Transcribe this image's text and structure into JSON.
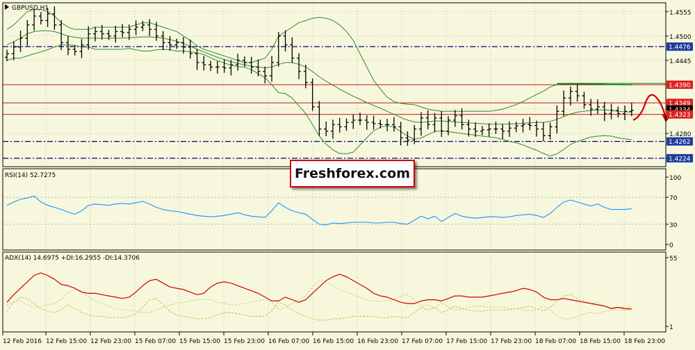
{
  "colors": {
    "background": "#F7F7DE",
    "panel_border": "#000000",
    "grid": "#9B9B80",
    "candle": "#000000",
    "bollinger": "#2E8B2E",
    "level_red": "#CC1111",
    "level_blue": "#000080",
    "price_box_red": "#E02020",
    "price_box_blue": "#1F3C9C",
    "price_box_black": "#000000",
    "rsi_line": "#1E90FF",
    "adx_line": "#D00000",
    "plus_di_line": "#9ACD32",
    "minus_di_line": "#CCCC66",
    "forecast_arrow": "#CC0000",
    "channel_line": "#008000"
  },
  "watermark": {
    "text": "Freshforex.com"
  },
  "chart_data": [
    {
      "type": "candlestick",
      "title": "GBPUSD,H1",
      "ylim": [
        1.4205,
        1.4575
      ],
      "y_ticks": [
        "1.4555",
        "1.4500",
        "1.4445",
        "1.4390",
        "1.4335",
        "1.4280",
        "1.4224"
      ],
      "y_tick_values": [
        1.4555,
        1.45,
        1.4445,
        1.439,
        1.4335,
        1.428,
        1.4224
      ],
      "x_ticks": [
        "12 Feb 2016",
        "12 Feb 15:00",
        "12 Feb 23:00",
        "15 Feb 07:00",
        "15 Feb 15:00",
        "15 Feb 23:00",
        "16 Feb 07:00",
        "16 Feb 15:00",
        "16 Feb 23:00",
        "17 Feb 07:00",
        "17 Feb 15:00",
        "17 Feb 23:00",
        "18 Feb 07:00",
        "18 Feb 15:00",
        "18 Feb 23:00"
      ],
      "grid": true,
      "close_prices": [
        1.446,
        1.4475,
        1.4495,
        1.4525,
        1.4545,
        1.4535,
        1.455,
        1.4525,
        1.4485,
        1.447,
        1.4465,
        1.448,
        1.4505,
        1.451,
        1.4505,
        1.45,
        1.451,
        1.4508,
        1.4515,
        1.452,
        1.4525,
        1.4515,
        1.45,
        1.4485,
        1.448,
        1.4485,
        1.4475,
        1.446,
        1.444,
        1.4435,
        1.443,
        1.443,
        1.4428,
        1.4435,
        1.4445,
        1.444,
        1.443,
        1.442,
        1.441,
        1.444,
        1.45,
        1.448,
        1.445,
        1.442,
        1.4395,
        1.434,
        1.429,
        1.4285,
        1.43,
        1.4295,
        1.4305,
        1.431,
        1.431,
        1.4305,
        1.4302,
        1.43,
        1.43,
        1.4295,
        1.427,
        1.4265,
        1.429,
        1.4315,
        1.43,
        1.4315,
        1.4285,
        1.431,
        1.432,
        1.43,
        1.429,
        1.4285,
        1.4288,
        1.429,
        1.429,
        1.4285,
        1.4292,
        1.4297,
        1.43,
        1.4298,
        1.429,
        1.4275,
        1.4295,
        1.433,
        1.436,
        1.4375,
        1.4365,
        1.4345,
        1.4335,
        1.434,
        1.4325,
        1.4332,
        1.4325,
        1.433,
        1.4332
      ],
      "bollinger_upper": [
        1.4515,
        1.4525,
        1.454,
        1.4555,
        1.456,
        1.456,
        1.4555,
        1.4545,
        1.453,
        1.452,
        1.4515,
        1.4515,
        1.4515,
        1.452,
        1.452,
        1.452,
        1.452,
        1.452,
        1.452,
        1.4525,
        1.453,
        1.453,
        1.4525,
        1.452,
        1.4515,
        1.451,
        1.45,
        1.449,
        1.4478,
        1.447,
        1.4465,
        1.446,
        1.4455,
        1.445,
        1.4445,
        1.444,
        1.444,
        1.4445,
        1.445,
        1.447,
        1.45,
        1.451,
        1.452,
        1.453,
        1.4535,
        1.454,
        1.4542,
        1.454,
        1.4535,
        1.4525,
        1.451,
        1.449,
        1.446,
        1.443,
        1.44,
        1.438,
        1.4362,
        1.4352,
        1.4348,
        1.4346,
        1.4345,
        1.434,
        1.4335,
        1.4332,
        1.433,
        1.433,
        1.433,
        1.433,
        1.433,
        1.433,
        1.433,
        1.433,
        1.4332,
        1.4335,
        1.434,
        1.4345,
        1.4352,
        1.436,
        1.4368,
        1.4375,
        1.4385,
        1.439,
        1.4392,
        1.4393,
        1.4393,
        1.4393,
        1.4392,
        1.4392,
        1.4391,
        1.439,
        1.439,
        1.439,
        1.439
      ],
      "bollinger_middle": [
        1.448,
        1.4487,
        1.4495,
        1.4505,
        1.451,
        1.4512,
        1.4512,
        1.451,
        1.4505,
        1.45,
        1.4497,
        1.4495,
        1.4495,
        1.4495,
        1.4495,
        1.4495,
        1.4495,
        1.4495,
        1.4496,
        1.4497,
        1.4498,
        1.4498,
        1.4497,
        1.4495,
        1.4492,
        1.4488,
        1.4483,
        1.4477,
        1.447,
        1.4464,
        1.4458,
        1.4452,
        1.4447,
        1.4442,
        1.4438,
        1.4435,
        1.4432,
        1.443,
        1.4428,
        1.443,
        1.4436,
        1.444,
        1.444,
        1.4436,
        1.443,
        1.442,
        1.4408,
        1.4398,
        1.4389,
        1.438,
        1.4372,
        1.4364,
        1.4357,
        1.435,
        1.4343,
        1.4337,
        1.433,
        1.4323,
        1.4316,
        1.431,
        1.4306,
        1.4305,
        1.4306,
        1.4308,
        1.4308,
        1.4307,
        1.4306,
        1.4305,
        1.4304,
        1.4303,
        1.4302,
        1.4301,
        1.4301,
        1.4301,
        1.4301,
        1.4302,
        1.4303,
        1.4304,
        1.4305,
        1.4305,
        1.4307,
        1.4312,
        1.4318,
        1.4324,
        1.4328,
        1.433,
        1.4332,
        1.4333,
        1.4333,
        1.4332,
        1.433,
        1.4329,
        1.4328
      ],
      "bollinger_lower": [
        1.4445,
        1.445,
        1.445,
        1.4455,
        1.446,
        1.4464,
        1.4469,
        1.4475,
        1.448,
        1.448,
        1.4479,
        1.4475,
        1.4475,
        1.447,
        1.447,
        1.447,
        1.447,
        1.447,
        1.4472,
        1.4469,
        1.4466,
        1.4466,
        1.4469,
        1.447,
        1.4469,
        1.4466,
        1.4466,
        1.4464,
        1.4462,
        1.4458,
        1.4451,
        1.4444,
        1.4439,
        1.4434,
        1.4431,
        1.443,
        1.4424,
        1.4415,
        1.4406,
        1.439,
        1.4372,
        1.437,
        1.436,
        1.4342,
        1.4325,
        1.43,
        1.4274,
        1.4256,
        1.4243,
        1.4235,
        1.4234,
        1.4238,
        1.4254,
        1.427,
        1.4286,
        1.4294,
        1.4298,
        1.4294,
        1.4284,
        1.4274,
        1.4267,
        1.427,
        1.4277,
        1.4284,
        1.4286,
        1.4284,
        1.4282,
        1.428,
        1.4278,
        1.4276,
        1.4274,
        1.4272,
        1.427,
        1.4267,
        1.4262,
        1.4259,
        1.4254,
        1.4248,
        1.4242,
        1.4235,
        1.4229,
        1.4234,
        1.4244,
        1.4255,
        1.4262,
        1.4267,
        1.4272,
        1.4274,
        1.4275,
        1.4274,
        1.427,
        1.4268,
        1.4266
      ],
      "levels": [
        {
          "value": 1.4476,
          "label": "1.4476",
          "style": "blue-dashdot"
        },
        {
          "value": 1.439,
          "label": "1.4390",
          "style": "red"
        },
        {
          "value": 1.4349,
          "label": "1.4349",
          "style": "red"
        },
        {
          "value": 1.4334,
          "label": "1.4334",
          "style": "current"
        },
        {
          "value": 1.4323,
          "label": "1.4323",
          "style": "red"
        },
        {
          "value": 1.4262,
          "label": "1.4262",
          "style": "blue-dashdot"
        },
        {
          "value": 1.4224,
          "label": "1.4224",
          "style": "blue-dashdot"
        }
      ]
    },
    {
      "type": "line",
      "title": "RSI(14) 52.7275",
      "ylim": [
        0,
        100
      ],
      "y_ticks": [
        "100",
        "70",
        "30",
        "0"
      ],
      "y_tick_values": [
        100,
        70,
        30,
        0
      ],
      "reference_lines": [
        70,
        30
      ],
      "values": [
        58,
        63,
        67,
        69,
        72,
        63,
        58,
        55,
        52,
        48,
        45,
        50,
        58,
        60,
        59,
        58,
        60,
        61,
        60,
        62,
        64,
        60,
        55,
        52,
        50,
        49,
        47,
        45,
        43,
        42,
        41,
        42,
        43,
        45,
        47,
        44,
        42,
        41,
        40,
        50,
        62,
        55,
        50,
        47,
        45,
        37,
        30,
        29,
        32,
        31,
        32,
        33,
        33,
        33,
        32,
        32,
        33,
        33,
        31,
        30,
        36,
        42,
        38,
        42,
        34,
        40,
        46,
        42,
        40,
        39,
        40,
        41,
        41,
        40,
        41,
        43,
        44,
        45,
        43,
        40,
        46,
        55,
        63,
        66,
        63,
        60,
        57,
        60,
        55,
        52,
        52,
        52,
        53
      ]
    },
    {
      "type": "line",
      "title": "ADX(14) 14.6975 +DI:16.2955 -DI:14.3706",
      "ylim": [
        0,
        55
      ],
      "y_ticks": [
        "55",
        "1"
      ],
      "y_tick_values": [
        55,
        1
      ],
      "series": [
        {
          "name": "ADX(14)",
          "values": [
            20,
            26,
            31,
            36,
            41,
            43,
            41,
            38,
            34,
            33,
            31,
            28,
            27,
            27,
            26,
            25,
            24,
            23,
            24,
            28,
            33,
            37,
            38,
            35,
            32,
            31,
            30,
            28,
            26,
            27,
            32,
            35,
            36,
            35,
            33,
            31,
            29,
            27,
            24,
            21,
            21,
            24,
            22,
            20,
            22,
            27,
            32,
            37,
            40,
            42,
            40,
            37,
            34,
            31,
            27,
            25,
            24,
            22,
            20,
            19,
            19,
            21,
            22,
            22,
            21,
            23,
            25,
            25,
            24,
            24,
            24,
            25,
            26,
            27,
            28,
            29,
            31,
            30,
            28,
            24,
            22,
            22,
            23,
            22,
            21,
            20,
            19,
            18,
            17,
            15,
            16,
            15,
            14.7
          ]
        },
        {
          "name": "+DI",
          "values": [
            13,
            20,
            24,
            23,
            19,
            15,
            13,
            12,
            14,
            18,
            15,
            12,
            10,
            9,
            9,
            8,
            8,
            8,
            9,
            11,
            16,
            22,
            23,
            18,
            13,
            10,
            9,
            8,
            7,
            7,
            8,
            10,
            12,
            12,
            11,
            10,
            9,
            9,
            9,
            13,
            20,
            18,
            14,
            11,
            9,
            7,
            6,
            6,
            7,
            7,
            8,
            9,
            9,
            9,
            9,
            8,
            8,
            9,
            8,
            8,
            12,
            16,
            14,
            16,
            12,
            14,
            17,
            15,
            14,
            13,
            13,
            14,
            14,
            14,
            14,
            15,
            16,
            17,
            15,
            13,
            16,
            21,
            25,
            26,
            23,
            21,
            19,
            20,
            17,
            16,
            16,
            16,
            16.3
          ]
        },
        {
          "name": "-DI",
          "values": [
            18,
            20,
            21,
            18,
            16,
            17,
            18,
            19,
            22,
            28,
            30,
            29,
            24,
            21,
            19,
            17,
            15,
            14,
            14,
            13,
            12,
            12,
            14,
            16,
            18,
            19,
            20,
            21,
            22,
            22,
            22,
            20,
            19,
            18,
            18,
            19,
            20,
            21,
            22,
            20,
            14,
            16,
            19,
            22,
            25,
            32,
            37,
            36,
            33,
            30,
            28,
            26,
            24,
            22,
            21,
            21,
            21,
            22,
            25,
            26,
            22,
            17,
            18,
            15,
            20,
            16,
            14,
            15,
            16,
            17,
            17,
            16,
            16,
            16,
            15,
            15,
            14,
            13,
            14,
            17,
            14,
            9,
            7,
            7,
            9,
            11,
            12,
            11,
            13,
            14,
            14,
            14,
            14.4
          ]
        }
      ]
    }
  ]
}
